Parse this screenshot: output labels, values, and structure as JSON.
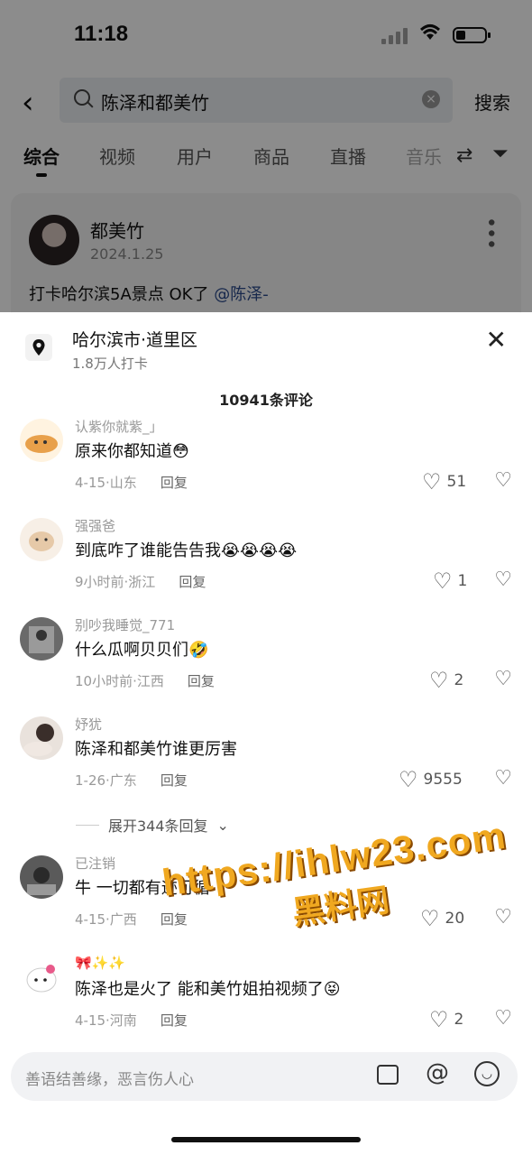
{
  "status": {
    "time": "11:18"
  },
  "search": {
    "query": "陈泽和都美竹",
    "button": "搜索"
  },
  "tabs": [
    "综合",
    "视频",
    "用户",
    "商品",
    "直播",
    "音乐"
  ],
  "card": {
    "name": "都美竹",
    "date": "2024.1.25",
    "text": "打卡哈尔滨5A景点 OK了",
    "mention": "@陈泽-"
  },
  "sheet": {
    "location": "哈尔滨市·道里区",
    "checkins": "1.8万人打卡",
    "comment_count": "10941条评论"
  },
  "comments": [
    {
      "user": "认紫你就紫_」",
      "text": "原来你都知道",
      "emoji": "😳",
      "meta": "4-15·山东",
      "reply": "回复",
      "likes": "51"
    },
    {
      "user": "强强爸",
      "text": "到底咋了谁能告告我",
      "emoji": "😭😭😭😭",
      "meta": "9小时前·浙江",
      "reply": "回复",
      "likes": "1"
    },
    {
      "user": "别吵我睡觉_771",
      "text": "什么瓜啊贝贝们",
      "emoji": "🤣",
      "meta": "10小时前·江西",
      "reply": "回复",
      "likes": "2"
    },
    {
      "user": "妤犹",
      "text": "陈泽和都美竹谁更厉害",
      "emoji": "",
      "meta": "1-26·广东",
      "reply": "回复",
      "likes": "9555"
    },
    {
      "user": "已注销",
      "text": "牛 一切都有迹可循",
      "emoji": "",
      "meta": "4-15·广西",
      "reply": "回复",
      "likes": "20"
    },
    {
      "user": "🎀✨✨",
      "text": "陈泽也是火了 能和美竹姐拍视频了",
      "emoji": "😝",
      "meta": "4-15·河南",
      "reply": "回复",
      "likes": "2"
    }
  ],
  "expand": "展开344条回复",
  "watermark": {
    "url": "https://ihlw23.com",
    "cn": "黑料网"
  },
  "input": {
    "placeholder": "善语结善缘，恶言伤人心"
  }
}
